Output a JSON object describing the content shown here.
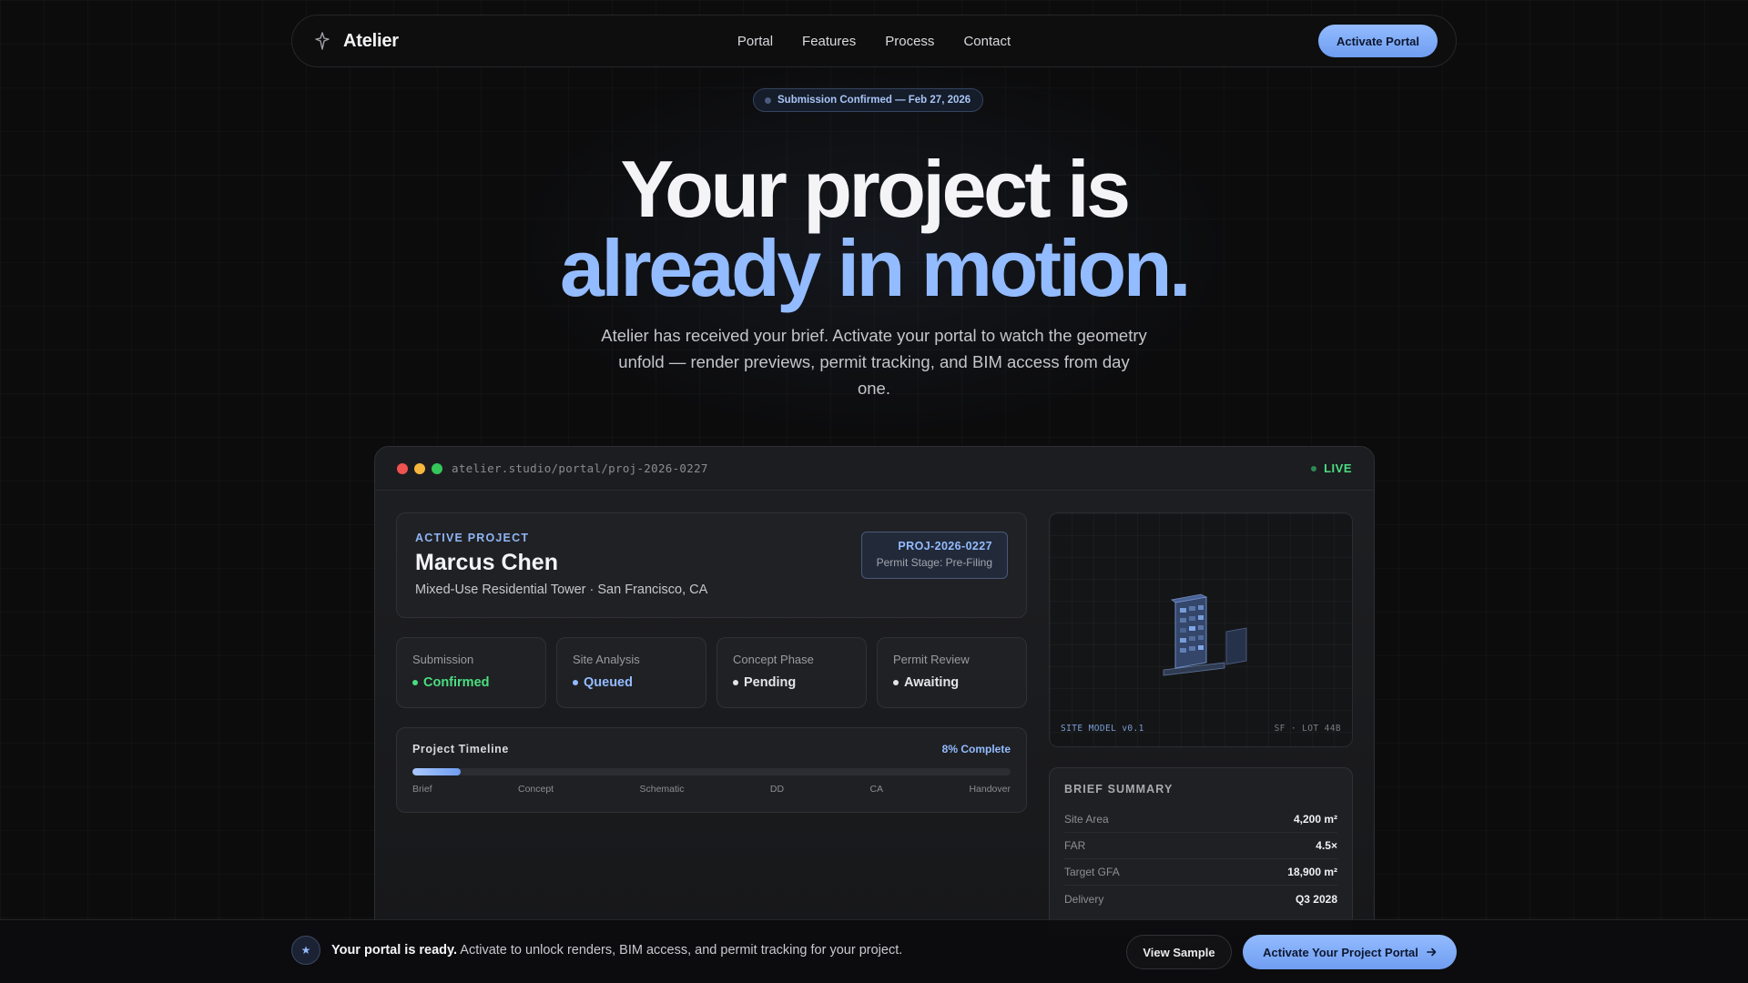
{
  "brand": {
    "name": "Atelier"
  },
  "nav": {
    "links": [
      "Portal",
      "Features",
      "Process",
      "Contact"
    ],
    "cta": "Activate Portal"
  },
  "badge": {
    "text": "Submission Confirmed — Feb 27, 2026"
  },
  "hero": {
    "line1": "Your project is",
    "line2": "already in motion.",
    "subtitle": "Atelier has received your brief. Activate your portal to watch the geometry unfold — render previews, permit tracking, and BIM access from day one."
  },
  "window": {
    "url": "atelier.studio/portal/proj-2026-0227",
    "status": "LIVE"
  },
  "project": {
    "eyebrow": "ACTIVE PROJECT",
    "client": "Marcus Chen",
    "description": "Mixed-Use Residential Tower · San Francisco, CA",
    "code": "PROJ-2026-0227",
    "stage": "Permit Stage: Pre-Filing"
  },
  "stages": [
    {
      "label": "Submission",
      "value": "Confirmed",
      "color": "#4ade80"
    },
    {
      "label": "Site Analysis",
      "value": "Queued",
      "color": "#93bbff"
    },
    {
      "label": "Concept Phase",
      "value": "Pending",
      "color": "#e5e5e8"
    },
    {
      "label": "Permit Review",
      "value": "Awaiting",
      "color": "#e5e5e8"
    }
  ],
  "timeline": {
    "title": "Project Timeline",
    "percent_label": "8% Complete",
    "progress": 0.08,
    "steps": [
      "Brief",
      "Concept",
      "Schematic",
      "DD",
      "CA",
      "Handover"
    ]
  },
  "model": {
    "label_left": "SITE MODEL v0.1",
    "label_right": "SF · LOT 44B"
  },
  "brief": {
    "title": "BRIEF SUMMARY",
    "rows": [
      {
        "key": "Site Area",
        "value": "4,200 m²"
      },
      {
        "key": "FAR",
        "value": "4.5×"
      },
      {
        "key": "Target GFA",
        "value": "18,900 m²"
      },
      {
        "key": "Delivery",
        "value": "Q3 2028"
      }
    ]
  },
  "bottom": {
    "lead": "Your portal is ready.",
    "text": " Activate to unlock renders, BIM access, and permit tracking for your project.",
    "secondary": "View Sample",
    "primary": "Activate Your Project Portal"
  },
  "colors": {
    "accent": "#93bbff",
    "success": "#4ade80",
    "bg": "#0c0c0d"
  },
  "icons": {
    "brand": "sparkle-logo-icon",
    "bottom": "star-icon",
    "cta": "arrow-right-icon"
  }
}
